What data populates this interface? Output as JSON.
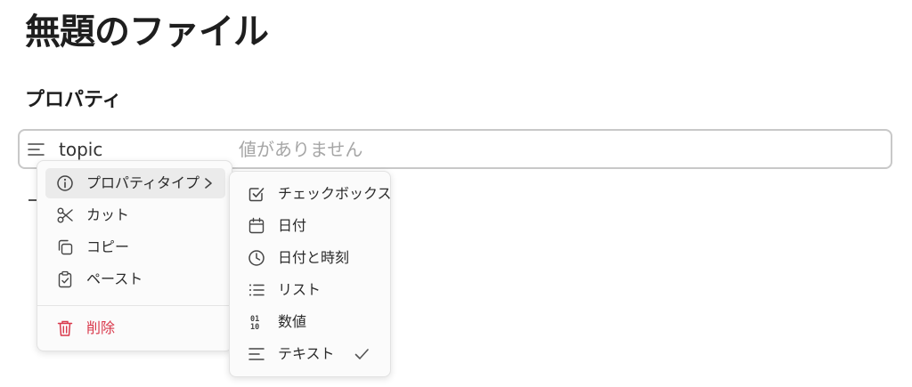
{
  "page": {
    "title": "無題のファイル",
    "properties_heading": "プロパティ"
  },
  "property_row": {
    "type_icon": "text-lines-icon",
    "key": "topic",
    "value_placeholder": "値がありません"
  },
  "context_menu": {
    "items": [
      {
        "icon": "info-icon",
        "label": "プロパティタイプ",
        "has_submenu": true
      },
      {
        "icon": "scissors-icon",
        "label": "カット"
      },
      {
        "icon": "copy-icon",
        "label": "コピー"
      },
      {
        "icon": "clipboard-icon",
        "label": "ペースト"
      },
      {
        "icon": "trash-icon",
        "label": "削除",
        "danger": true
      }
    ]
  },
  "type_submenu": {
    "items": [
      {
        "icon": "checkbox-icon",
        "label": "チェックボックス"
      },
      {
        "icon": "calendar-icon",
        "label": "日付"
      },
      {
        "icon": "clock-icon",
        "label": "日付と時刻"
      },
      {
        "icon": "list-icon",
        "label": "リスト"
      },
      {
        "icon": "number-icon",
        "label": "数値"
      },
      {
        "icon": "text-lines-icon",
        "label": "テキスト",
        "selected": true
      }
    ]
  },
  "colors": {
    "danger": "#d9384b",
    "placeholder": "#a6a6a6",
    "highlight": "#ebebeb"
  }
}
